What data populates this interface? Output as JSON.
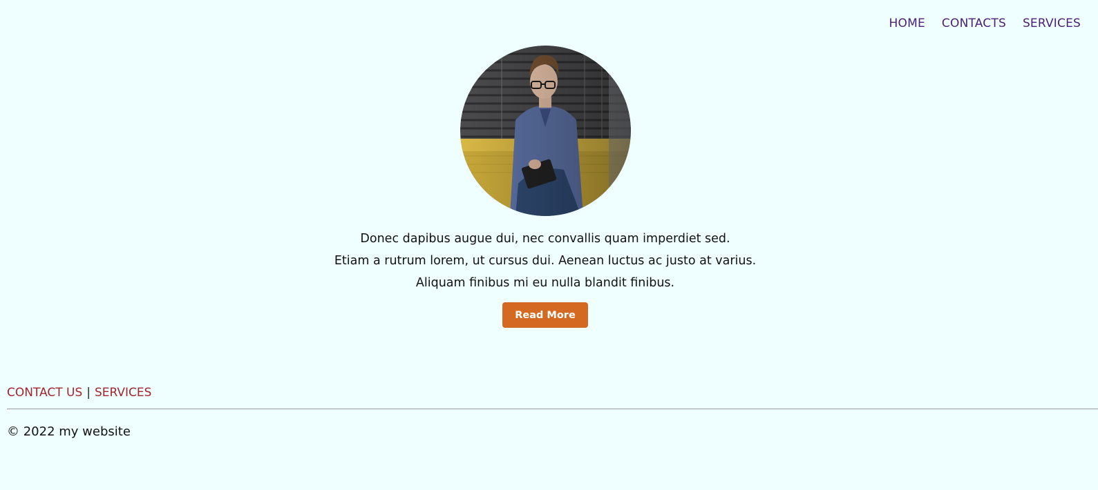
{
  "nav": {
    "items": [
      {
        "label": "HOME"
      },
      {
        "label": "CONTACTS"
      },
      {
        "label": "SERVICES"
      }
    ]
  },
  "hero": {
    "lines": [
      "Donec dapibus augue dui, nec convallis quam imperdiet sed.",
      "Etiam a rutrum lorem, ut cursus dui. Aenean luctus ac justo at varius.",
      "Aliquam finibus mi eu nulla blandit finibus."
    ],
    "button_label": "Read More"
  },
  "footer": {
    "links": [
      {
        "label": "CONTACT US"
      },
      {
        "label": "SERVICES"
      }
    ],
    "separator": "|",
    "copyright": "© 2022 my website"
  },
  "colors": {
    "background": "#efffff",
    "nav_link": "#4a1e78",
    "footer_link": "#a3242a",
    "button": "#d46a22"
  }
}
